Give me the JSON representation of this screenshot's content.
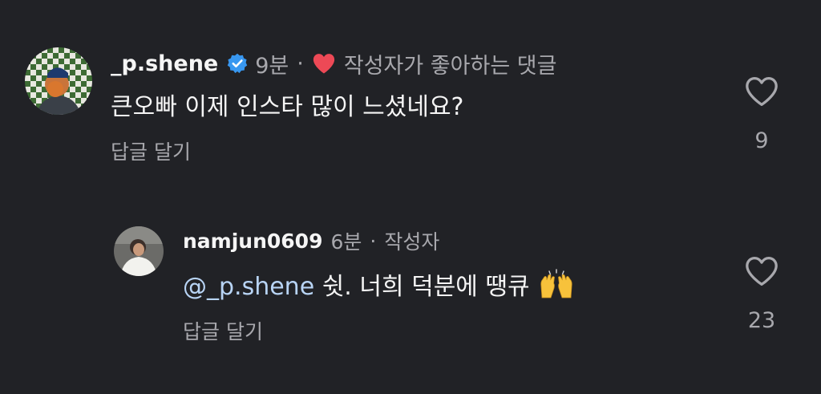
{
  "comments": [
    {
      "username": "_p.shene",
      "verified_icon": "verified-badge-icon",
      "time": "9분",
      "separator": "·",
      "author_liked": "작성자가 좋아하는 댓글",
      "author_liked_icon": "red-heart-icon",
      "text": "큰오빠 이제 인스타 많이 느셨네요?",
      "reply_label": "답글 달기",
      "like_icon": "heart-outline-icon",
      "like_count": "9"
    },
    {
      "username": "namjun0609",
      "time": "6분",
      "separator": "·",
      "author_tag": "작성자",
      "mention": "@_p.shene",
      "text": " 쉿. 너희 덕분에 땡큐",
      "emoji": "raising-hands-emoji",
      "reply_label": "답글 달기",
      "like_icon": "heart-outline-icon",
      "like_count": "23"
    }
  ],
  "colors": {
    "background": "#212226",
    "text": "#f5f5f5",
    "secondary": "#a8a8ad",
    "mention": "#b8d4f5",
    "verified": "#3897f0",
    "heart": "#ed4956"
  }
}
